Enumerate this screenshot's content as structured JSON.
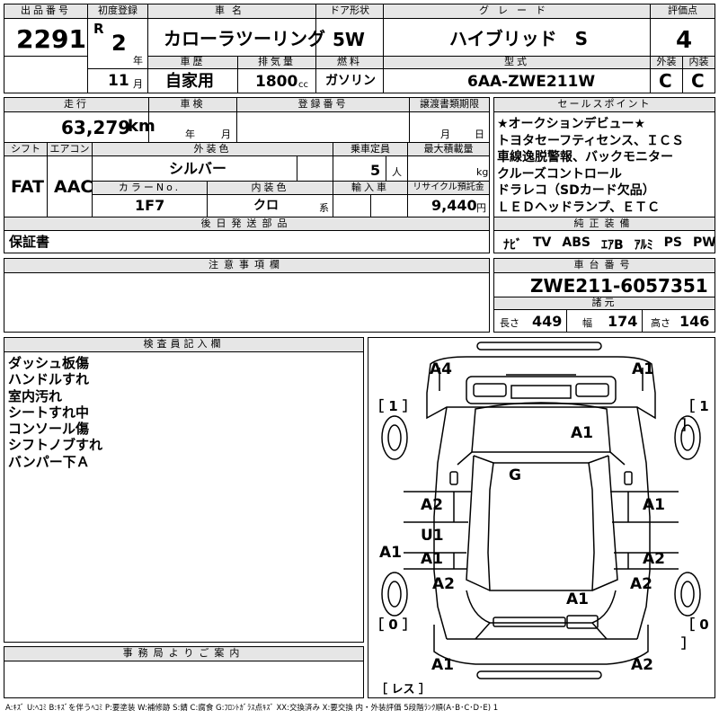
{
  "header": {
    "lot_no_label": "出品番号",
    "lot_no": "2291",
    "first_reg_label": "初度登録",
    "era": "R",
    "year": "2",
    "year_unit": "年",
    "month": "11",
    "month_unit": "月",
    "car_name_label": "車名",
    "car_name": "カローラツーリング",
    "door_label": "ドア形状",
    "door": "5W",
    "grade_label": "グレード",
    "grade": "ハイブリッド　S",
    "score_label": "評価点",
    "score": "4",
    "history_label": "車歴",
    "history": "自家用",
    "displacement_label": "排気量",
    "displacement": "1800",
    "displacement_unit": "cc",
    "fuel_label": "燃料",
    "fuel": "ガソリン",
    "model_label": "型式",
    "model": "6AA-ZWE211W",
    "ext_label": "外装",
    "ext_score": "C",
    "int_label": "内装",
    "int_score": "C"
  },
  "row2": {
    "mileage_label": "走行",
    "mileage": "63,279",
    "mileage_unit": "km",
    "inspection_label": "車検",
    "insp_year_unit": "年",
    "insp_month_unit": "月",
    "reg_no_label": "登録番号",
    "transfer_label": "譲渡書類期限",
    "transfer_month_unit": "月",
    "transfer_day_unit": "日",
    "shift_label": "シフト",
    "shift": "FAT",
    "ac_label": "エアコン",
    "ac": "AAC",
    "ext_color_label": "外装色",
    "ext_color": "シルバー",
    "capacity_label": "乗車定員",
    "capacity": "5",
    "capacity_unit": "人",
    "load_label": "最大積載量",
    "load_unit": "kg",
    "color_no_label": "カラーNo.",
    "color_no": "1F7",
    "int_color_label": "内装色",
    "int_color": "クロ",
    "int_color_unit": "系",
    "import_label": "輸入車",
    "recycle_label": "リサイクル預託金",
    "recycle": "9,440",
    "recycle_unit": "円",
    "later_parts_label": "後日発送部品",
    "later_parts": "保証書"
  },
  "sales_points": {
    "label": "セールスポイント",
    "lines": [
      "★オークションデビュー★",
      "トヨタセーフティセンス、ＩＣＳ",
      "車線逸脱警報、バックモニター",
      "クルーズコントロール",
      "ドラレコ（SDカード欠品）",
      "ＬＥＤヘッドランプ、ＥＴＣ"
    ]
  },
  "equipment": {
    "label": "純正装備",
    "items": [
      "ﾅﾋﾞ",
      "TV",
      "ABS",
      "ｴｱB",
      "ｱﾙﾐ",
      "PS",
      "PW"
    ]
  },
  "notes": {
    "label": "注意事項欄"
  },
  "chassis": {
    "label": "車台番号",
    "number": "ZWE211-6057351",
    "dims_label": "諸元",
    "length_label": "長さ",
    "length": "449",
    "width_label": "幅",
    "width": "174",
    "height_label": "高さ",
    "height": "146"
  },
  "inspector": {
    "label": "検査員記入欄",
    "lines": [
      "ダッシュ板傷",
      "ハンドルすれ",
      "室内汚れ",
      "シートすれ中",
      "コンソール傷",
      "シフトノブすれ",
      "バンパー下Ａ"
    ]
  },
  "office": {
    "label": "事務局よりご案内"
  },
  "diagram": {
    "marks": {
      "front_left_corner": "A4",
      "front_right_corner": "A1",
      "tire_fl": "［ 1 ］",
      "tire_fr": "［ 1 ］",
      "hood": "A1",
      "windshield": "G",
      "fl_door": "A2",
      "fr_door": "A1",
      "left_pillar": "U1",
      "left_pillar2": "A1",
      "left_fender": "A1",
      "rr_right_door": "A2",
      "rl_door": "A2",
      "rr_door": "A2",
      "roof": "A1",
      "tire_rl": "［ 0 ］",
      "tire_rr": "［ 0 ］",
      "rear_left": "A1",
      "rear_right": "A2",
      "spare": "［ レス ］"
    }
  },
  "legend": "A:ｷｽﾞ U:ﾍｺﾐ B:ｷｽﾞを伴うﾍｺﾐ P:要塗装 W:補修跡 S:錆 C:腐食 G:ﾌﾛﾝﾄｶﾞﾗｽ点ｷｽﾞ XX:交換済み X:要交換 内・外装評価 5段階ﾗﾝｸ順(A･B･C･D･E) 1"
}
